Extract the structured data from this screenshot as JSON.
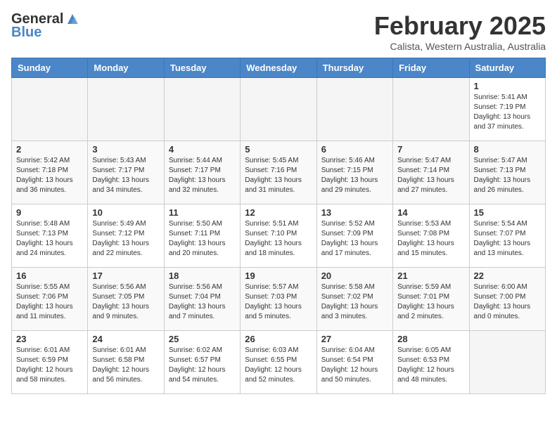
{
  "logo": {
    "general": "General",
    "blue": "Blue"
  },
  "header": {
    "month": "February 2025",
    "location": "Calista, Western Australia, Australia"
  },
  "days_of_week": [
    "Sunday",
    "Monday",
    "Tuesday",
    "Wednesday",
    "Thursday",
    "Friday",
    "Saturday"
  ],
  "weeks": [
    [
      {
        "day": "",
        "empty": true
      },
      {
        "day": "",
        "empty": true
      },
      {
        "day": "",
        "empty": true
      },
      {
        "day": "",
        "empty": true
      },
      {
        "day": "",
        "empty": true
      },
      {
        "day": "",
        "empty": true
      },
      {
        "day": "1",
        "sunrise": "Sunrise: 5:41 AM",
        "sunset": "Sunset: 7:19 PM",
        "daylight": "Daylight: 13 hours and 37 minutes."
      }
    ],
    [
      {
        "day": "2",
        "sunrise": "Sunrise: 5:42 AM",
        "sunset": "Sunset: 7:18 PM",
        "daylight": "Daylight: 13 hours and 36 minutes."
      },
      {
        "day": "3",
        "sunrise": "Sunrise: 5:43 AM",
        "sunset": "Sunset: 7:17 PM",
        "daylight": "Daylight: 13 hours and 34 minutes."
      },
      {
        "day": "4",
        "sunrise": "Sunrise: 5:44 AM",
        "sunset": "Sunset: 7:17 PM",
        "daylight": "Daylight: 13 hours and 32 minutes."
      },
      {
        "day": "5",
        "sunrise": "Sunrise: 5:45 AM",
        "sunset": "Sunset: 7:16 PM",
        "daylight": "Daylight: 13 hours and 31 minutes."
      },
      {
        "day": "6",
        "sunrise": "Sunrise: 5:46 AM",
        "sunset": "Sunset: 7:15 PM",
        "daylight": "Daylight: 13 hours and 29 minutes."
      },
      {
        "day": "7",
        "sunrise": "Sunrise: 5:47 AM",
        "sunset": "Sunset: 7:14 PM",
        "daylight": "Daylight: 13 hours and 27 minutes."
      },
      {
        "day": "8",
        "sunrise": "Sunrise: 5:47 AM",
        "sunset": "Sunset: 7:13 PM",
        "daylight": "Daylight: 13 hours and 26 minutes."
      }
    ],
    [
      {
        "day": "9",
        "sunrise": "Sunrise: 5:48 AM",
        "sunset": "Sunset: 7:13 PM",
        "daylight": "Daylight: 13 hours and 24 minutes."
      },
      {
        "day": "10",
        "sunrise": "Sunrise: 5:49 AM",
        "sunset": "Sunset: 7:12 PM",
        "daylight": "Daylight: 13 hours and 22 minutes."
      },
      {
        "day": "11",
        "sunrise": "Sunrise: 5:50 AM",
        "sunset": "Sunset: 7:11 PM",
        "daylight": "Daylight: 13 hours and 20 minutes."
      },
      {
        "day": "12",
        "sunrise": "Sunrise: 5:51 AM",
        "sunset": "Sunset: 7:10 PM",
        "daylight": "Daylight: 13 hours and 18 minutes."
      },
      {
        "day": "13",
        "sunrise": "Sunrise: 5:52 AM",
        "sunset": "Sunset: 7:09 PM",
        "daylight": "Daylight: 13 hours and 17 minutes."
      },
      {
        "day": "14",
        "sunrise": "Sunrise: 5:53 AM",
        "sunset": "Sunset: 7:08 PM",
        "daylight": "Daylight: 13 hours and 15 minutes."
      },
      {
        "day": "15",
        "sunrise": "Sunrise: 5:54 AM",
        "sunset": "Sunset: 7:07 PM",
        "daylight": "Daylight: 13 hours and 13 minutes."
      }
    ],
    [
      {
        "day": "16",
        "sunrise": "Sunrise: 5:55 AM",
        "sunset": "Sunset: 7:06 PM",
        "daylight": "Daylight: 13 hours and 11 minutes."
      },
      {
        "day": "17",
        "sunrise": "Sunrise: 5:56 AM",
        "sunset": "Sunset: 7:05 PM",
        "daylight": "Daylight: 13 hours and 9 minutes."
      },
      {
        "day": "18",
        "sunrise": "Sunrise: 5:56 AM",
        "sunset": "Sunset: 7:04 PM",
        "daylight": "Daylight: 13 hours and 7 minutes."
      },
      {
        "day": "19",
        "sunrise": "Sunrise: 5:57 AM",
        "sunset": "Sunset: 7:03 PM",
        "daylight": "Daylight: 13 hours and 5 minutes."
      },
      {
        "day": "20",
        "sunrise": "Sunrise: 5:58 AM",
        "sunset": "Sunset: 7:02 PM",
        "daylight": "Daylight: 13 hours and 3 minutes."
      },
      {
        "day": "21",
        "sunrise": "Sunrise: 5:59 AM",
        "sunset": "Sunset: 7:01 PM",
        "daylight": "Daylight: 13 hours and 2 minutes."
      },
      {
        "day": "22",
        "sunrise": "Sunrise: 6:00 AM",
        "sunset": "Sunset: 7:00 PM",
        "daylight": "Daylight: 13 hours and 0 minutes."
      }
    ],
    [
      {
        "day": "23",
        "sunrise": "Sunrise: 6:01 AM",
        "sunset": "Sunset: 6:59 PM",
        "daylight": "Daylight: 12 hours and 58 minutes."
      },
      {
        "day": "24",
        "sunrise": "Sunrise: 6:01 AM",
        "sunset": "Sunset: 6:58 PM",
        "daylight": "Daylight: 12 hours and 56 minutes."
      },
      {
        "day": "25",
        "sunrise": "Sunrise: 6:02 AM",
        "sunset": "Sunset: 6:57 PM",
        "daylight": "Daylight: 12 hours and 54 minutes."
      },
      {
        "day": "26",
        "sunrise": "Sunrise: 6:03 AM",
        "sunset": "Sunset: 6:55 PM",
        "daylight": "Daylight: 12 hours and 52 minutes."
      },
      {
        "day": "27",
        "sunrise": "Sunrise: 6:04 AM",
        "sunset": "Sunset: 6:54 PM",
        "daylight": "Daylight: 12 hours and 50 minutes."
      },
      {
        "day": "28",
        "sunrise": "Sunrise: 6:05 AM",
        "sunset": "Sunset: 6:53 PM",
        "daylight": "Daylight: 12 hours and 48 minutes."
      },
      {
        "day": "",
        "empty": true
      }
    ]
  ]
}
